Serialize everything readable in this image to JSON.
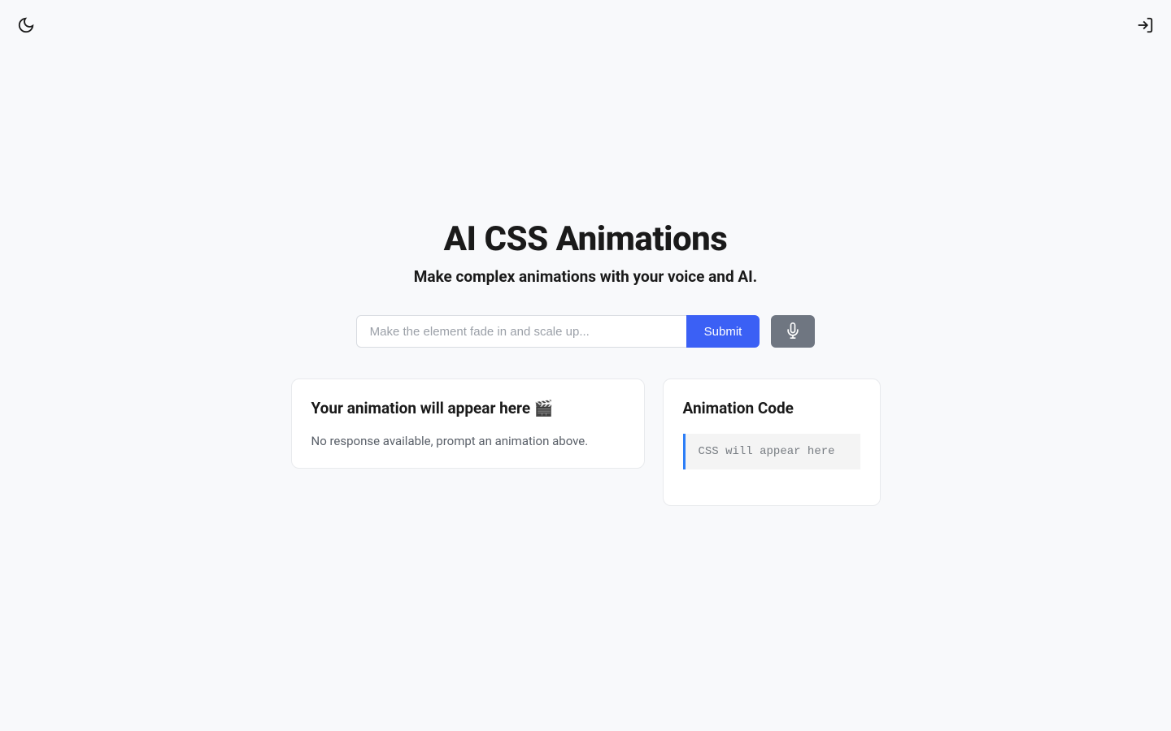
{
  "header": {
    "title": "AI CSS Animations",
    "subtitle": "Make complex animations with your voice and AI."
  },
  "input": {
    "placeholder": "Make the element fade in and scale up...",
    "submit_label": "Submit"
  },
  "preview_panel": {
    "title": "Your animation will appear here 🎬",
    "empty_text": "No response available, prompt an animation above."
  },
  "code_panel": {
    "title": "Animation Code",
    "placeholder": "CSS will appear here"
  }
}
